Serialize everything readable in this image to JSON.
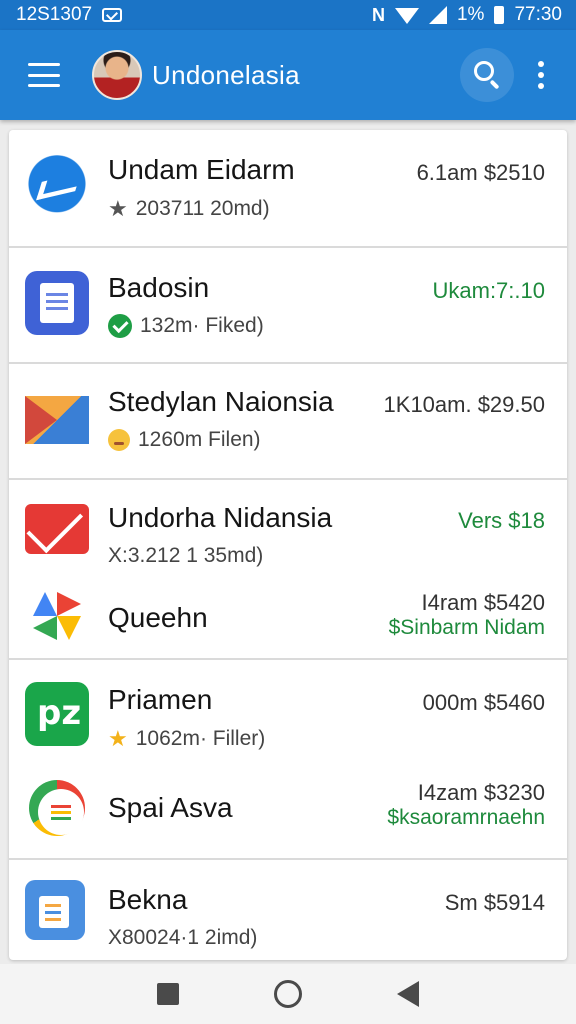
{
  "status_bar": {
    "time_left": "12S1307",
    "battery_text": "1%",
    "time_right": "77:30"
  },
  "app_bar": {
    "title": "Undonelasia"
  },
  "list": [
    {
      "title": "Undam Eidarm",
      "subtitle": "203711 20md)",
      "meta": "6.1am $2510",
      "badge": "star-icon"
    },
    {
      "title": "Badosin",
      "subtitle": "132m· Fiked)",
      "meta": "Ukam:7:.10",
      "badge": "check-icon"
    },
    {
      "title": "Stedylan Naionsia",
      "subtitle": "1260m Filen)",
      "meta": "1K10am. $29.50",
      "badge": "emoji-icon"
    },
    {
      "title": "Undorha Nidansia",
      "subtitle": "X:3.212 1 35md)",
      "meta": "Vers $18"
    },
    {
      "title": "Queehn",
      "meta": "I4ram $5420",
      "meta2": "$Sinbarm Nidam"
    },
    {
      "title": "Priamen",
      "subtitle": "1062m· Filler)",
      "meta": "000m $5460",
      "badge": "star-icon"
    },
    {
      "title": "Spai Asva",
      "meta": "I4zam $3230",
      "meta2": "$ksaoramrnaehn"
    },
    {
      "title": "Bekna",
      "subtitle": "X80024·1 2imd)",
      "meta": "Sm $5914"
    }
  ],
  "colors": {
    "status_bar": "#1b74c6",
    "app_bar": "#2180d3",
    "green_text": "#1e8a3c"
  }
}
